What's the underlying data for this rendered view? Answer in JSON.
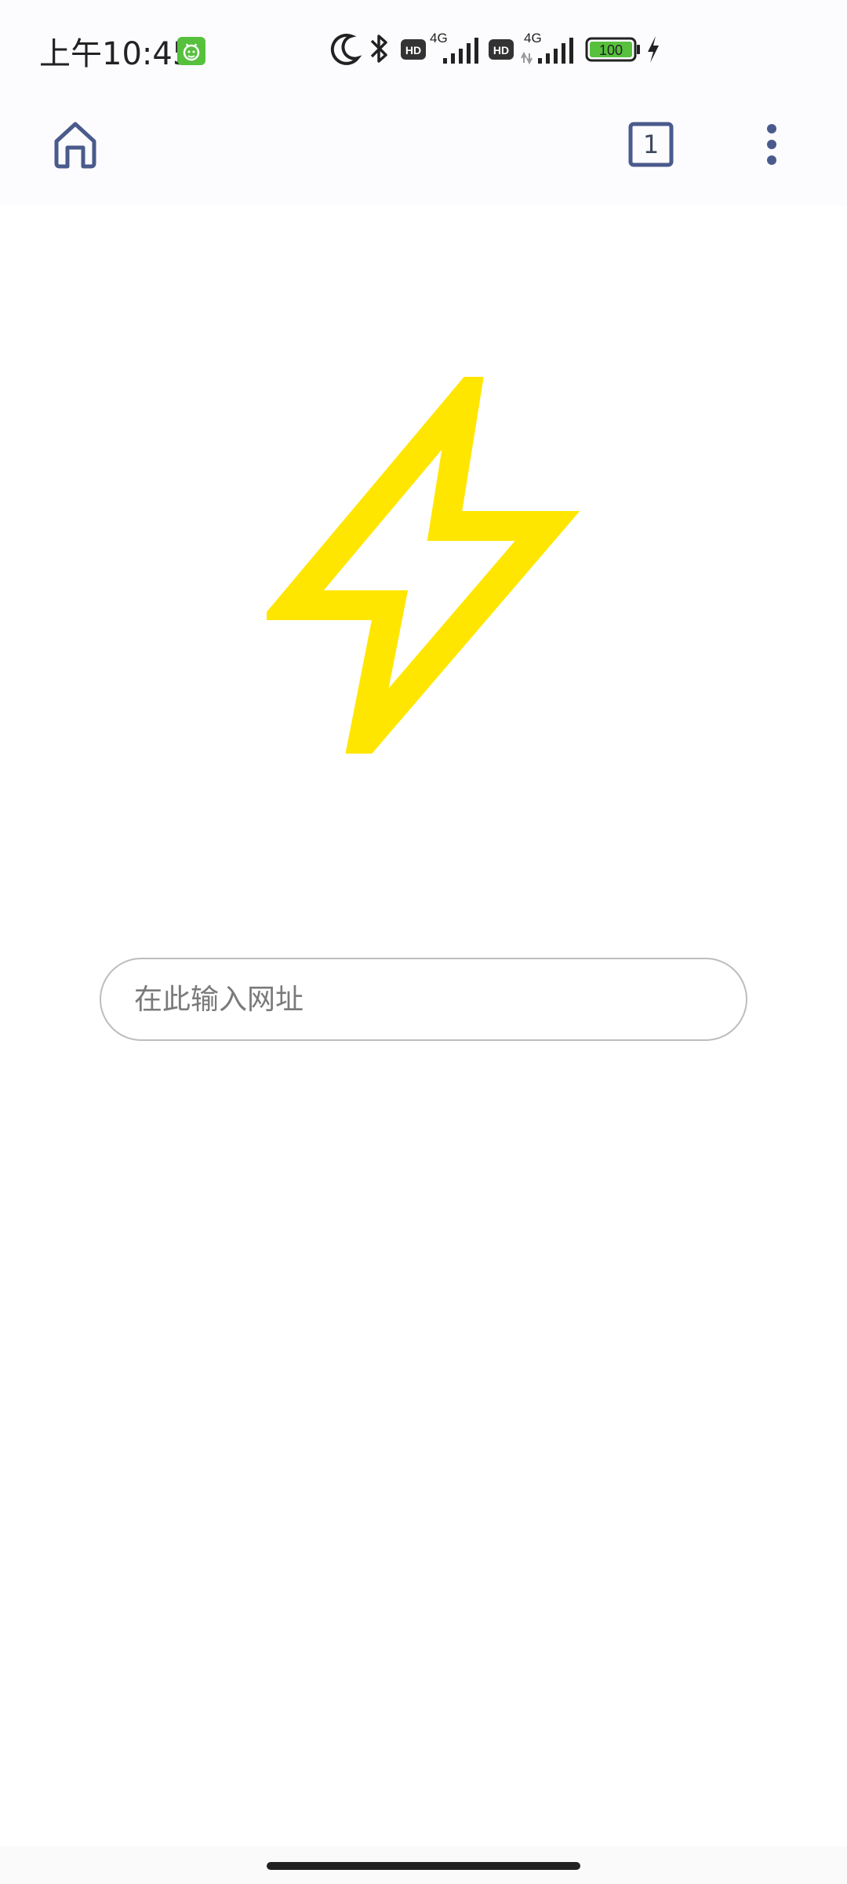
{
  "status_bar": {
    "time": "上午10:45",
    "notification_icon": "android-robot-icon",
    "icons": [
      "moon-icon",
      "bluetooth-icon",
      "hd-icon",
      "signal-4g-icon",
      "hd-icon",
      "signal-4g-icon",
      "battery-icon",
      "charging-icon"
    ],
    "network_1": "4G",
    "network_2": "4G",
    "hd_label": "HD",
    "battery_level": "100",
    "accent_color": "#57c03d"
  },
  "toolbar": {
    "home_icon": "home-icon",
    "tab_count": "1",
    "menu_icon": "more-vert-icon",
    "icon_color": "#4a5a8c"
  },
  "logo": {
    "icon": "lightning-bolt-icon",
    "color": "#ffe600"
  },
  "url_bar": {
    "placeholder": "在此输入网址",
    "value": ""
  }
}
